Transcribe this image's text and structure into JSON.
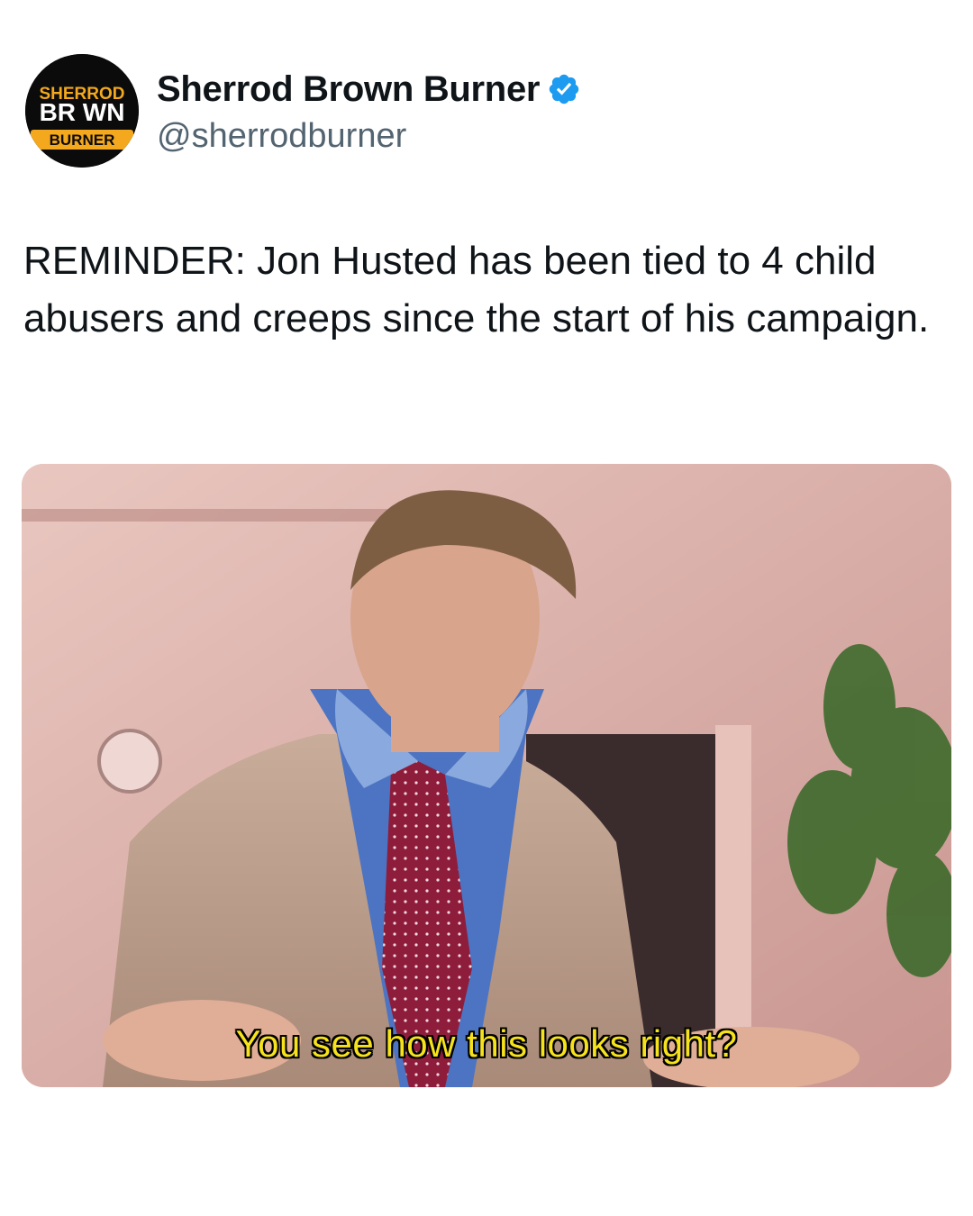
{
  "post": {
    "author": {
      "display_name": "Sherrod Brown Burner",
      "handle": "@sherrodburner",
      "verified": true,
      "verified_color": "#1d9bf0",
      "avatar": {
        "icon": "sherrod-brown-burner-logo",
        "logo_line1": "SHERROD",
        "logo_line2": "BR WN",
        "logo_line3": "BURNER",
        "accent": "#f4a81d"
      }
    },
    "text": "REMINDER: Jon Husted has been tied to 4 child abusers and creeps since the start of his campaign.",
    "media": {
      "subtitle": "You see how this looks right?"
    }
  }
}
